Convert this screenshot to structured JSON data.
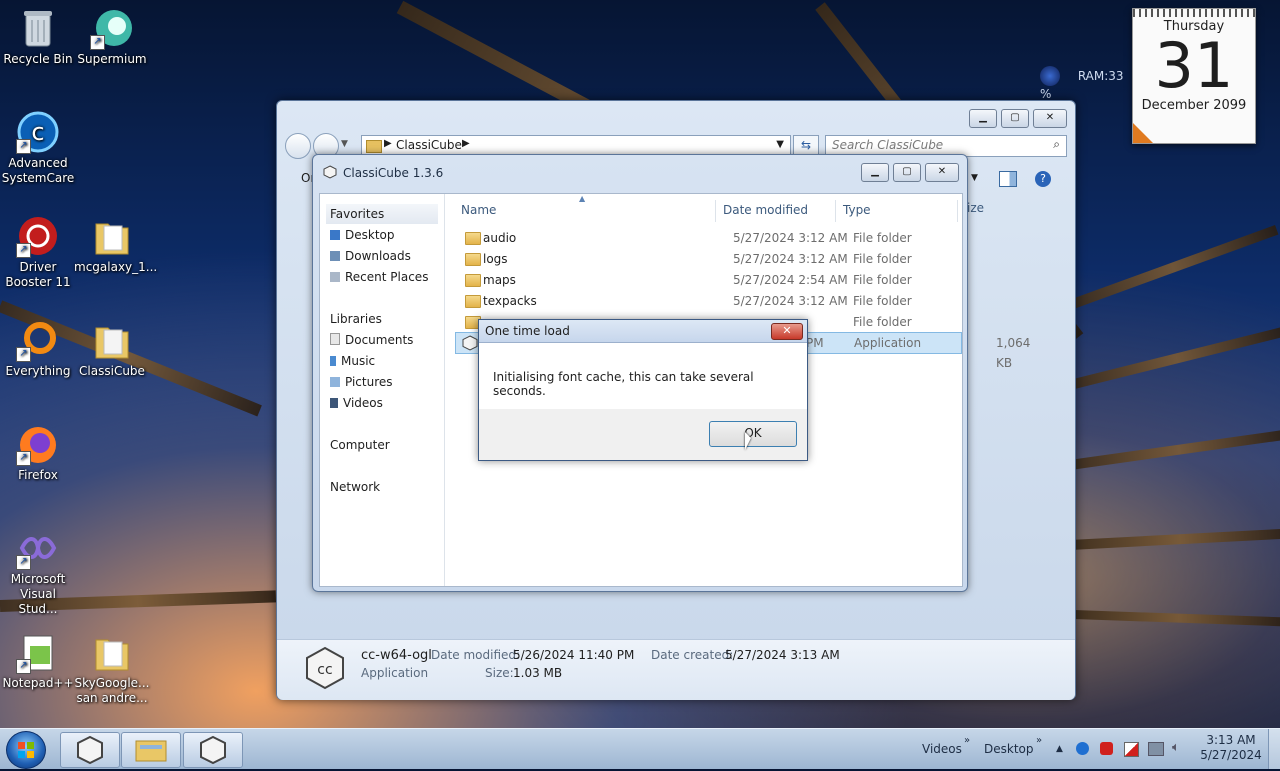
{
  "desktop": {
    "icons": [
      {
        "label": "Recycle Bin"
      },
      {
        "label": "Supermium"
      },
      {
        "label": "Advanced SystemCare"
      },
      {
        "label": "Driver Booster 11"
      },
      {
        "label": "mcgalaxy_1..."
      },
      {
        "label": "Everything"
      },
      {
        "label": "ClassiCube"
      },
      {
        "label": "Firefox"
      },
      {
        "label": "Microsoft Visual Stud..."
      },
      {
        "label": "Notepad++"
      },
      {
        "label": "SkyGoogle... san andre..."
      }
    ]
  },
  "gadgets": {
    "calendar": {
      "weekday": "Thursday",
      "day": "31",
      "month_year": "December 2099"
    },
    "ram": {
      "label": "RAM:33 %"
    }
  },
  "explorer": {
    "breadcrumb": "ClassiCube",
    "search_placeholder": "Search ClassiCube",
    "toolbar_partial": "Or",
    "size_header_partial": "ize",
    "details": {
      "name": "cc-w64-ogl",
      "kind": "Application",
      "date_modified_label": "Date modified:",
      "date_modified": "5/26/2024 11:40 PM",
      "date_created_label": "Date created:",
      "date_created": "5/27/2024 3:13 AM",
      "size_label": "Size:",
      "size": "1.03 MB"
    }
  },
  "classicube": {
    "title": "ClassiCube 1.3.6",
    "nav": {
      "favorites": "Favorites",
      "desktop": "Desktop",
      "downloads": "Downloads",
      "recent": "Recent Places",
      "libraries": "Libraries",
      "documents": "Documents",
      "music": "Music",
      "pictures": "Pictures",
      "videos": "Videos",
      "computer": "Computer",
      "network": "Network"
    },
    "columns": {
      "name": "Name",
      "date": "Date modified",
      "type": "Type"
    },
    "rows": [
      {
        "name": "audio",
        "date": "5/27/2024 3:12 AM",
        "type": "File folder",
        "size": ""
      },
      {
        "name": "logs",
        "date": "5/27/2024 3:12 AM",
        "type": "File folder",
        "size": ""
      },
      {
        "name": "maps",
        "date": "5/27/2024 2:54 AM",
        "type": "File folder",
        "size": ""
      },
      {
        "name": "texpacks",
        "date": "5/27/2024 3:12 AM",
        "type": "File folder",
        "size": ""
      },
      {
        "name": "",
        "date": "",
        "type": "File folder",
        "size": ""
      },
      {
        "name": "",
        "date": "PM",
        "type": "Application",
        "size": "1,064 KB"
      }
    ]
  },
  "dialog": {
    "title": "One time load",
    "message": "Initialising font cache, this can take several seconds.",
    "ok_label": "OK",
    "close_label": "✕"
  },
  "taskbar": {
    "videos": "Videos",
    "desktop": "Desktop",
    "time": "3:13 AM",
    "date": "5/27/2024"
  }
}
